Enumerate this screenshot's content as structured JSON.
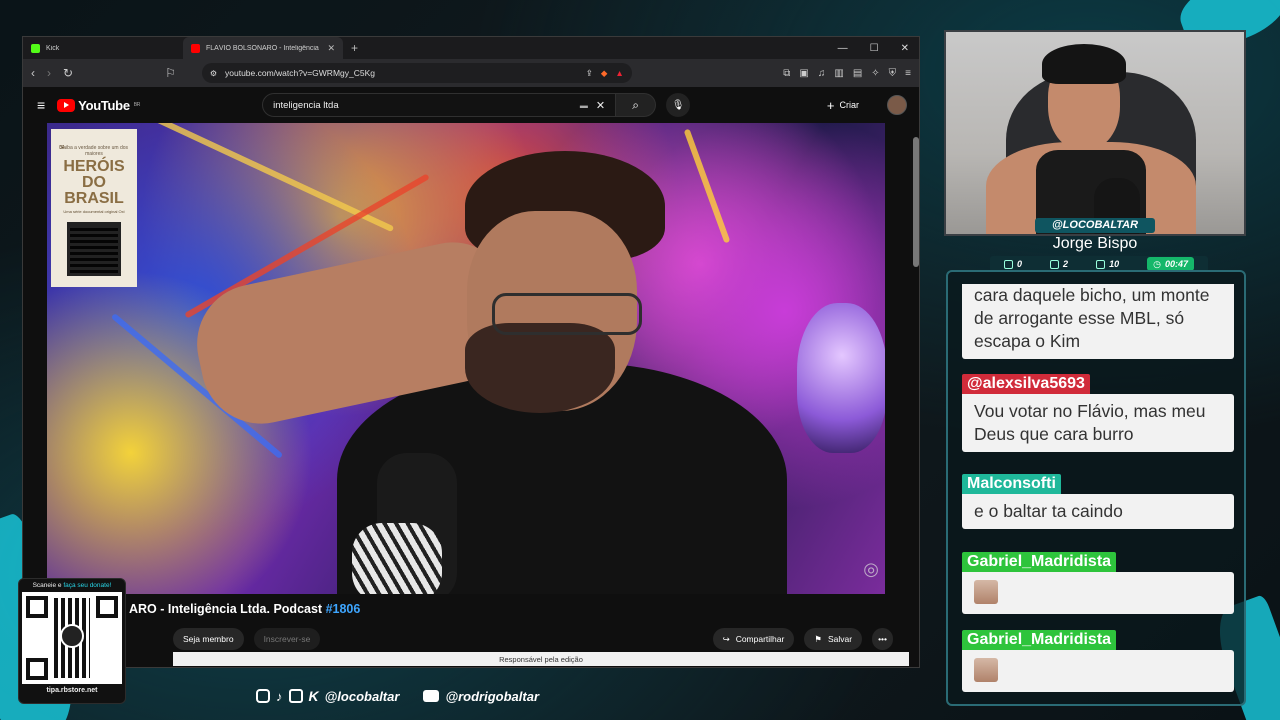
{
  "browser": {
    "tabs": [
      {
        "title": "Kick",
        "favicon_color": "#53fc18"
      },
      {
        "title": "FLÁVIO BOLSONARO - Inteligência",
        "favicon_color": "#ff0000"
      }
    ],
    "url": "youtube.com/watch?v=GWRMgy_C5Kg"
  },
  "youtube": {
    "logo_text": "YouTube",
    "region": "BR",
    "search_value": "inteligencia ltda",
    "create_label": "Criar",
    "video_title_prefix": "ARO - Inteligência Ltda. Podcast ",
    "video_title_tag": "#1806",
    "member_label": "Seja membro",
    "subscribe_label": "Inscrever-se",
    "share_label": "Compartilhar",
    "save_label": "Salvar",
    "responsible_text": "Responsável pela edição",
    "poster": {
      "number": "04",
      "tagline": "Saiba a verdade sobre um dos maiores",
      "title": "HERÓIS DO BRASIL",
      "subline": "Uma série documental original Oxi"
    }
  },
  "donate": {
    "caption_prefix": "Scaneie e ",
    "caption_highlight": "faça seu donate!",
    "site": "tipa.rbstore.net"
  },
  "social": {
    "handle1": "@locobaltar",
    "handle2": "@rodrigobaltar"
  },
  "streamer": {
    "handle": "@LOCOBALTAR",
    "name": "Jorge Bispo",
    "stats": {
      "comments": "0",
      "views": "2",
      "viewers": "10",
      "time": "00:47"
    }
  },
  "chat": {
    "messages": [
      {
        "user": "",
        "text": "cara daquele bicho, um monte de arrogante esse MBL, só escapa o Kim",
        "color": ""
      },
      {
        "user": "@alexsilva5693",
        "text": "Vou votar no Flávio, mas meu Deus que cara burro",
        "color": "#d12b3a"
      },
      {
        "user": "Malconsofti",
        "text": "e o baltar ta caindo",
        "color": "#1fb89a"
      },
      {
        "user": "Gabriel_Madridista",
        "text": "",
        "color": "#2ec43c"
      },
      {
        "user": "Gabriel_Madridista",
        "text": "",
        "color": "#2ec43c"
      }
    ]
  }
}
